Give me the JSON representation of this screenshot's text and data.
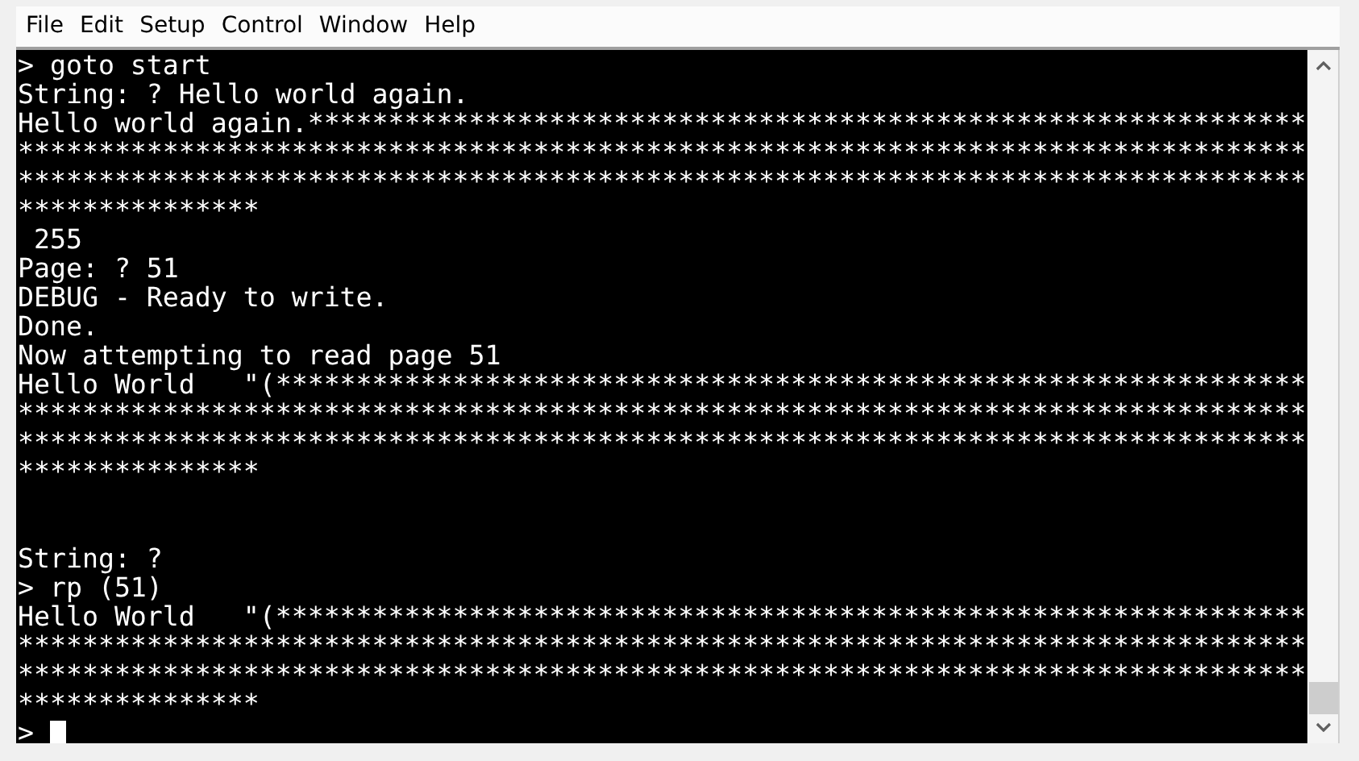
{
  "menu": [
    "File",
    "Edit",
    "Setup",
    "Control",
    "Window",
    "Help"
  ],
  "terminal": {
    "lines": [
      {
        "kind": "text",
        "text": "> goto start"
      },
      {
        "kind": "text",
        "text": "String: ? Hello world again."
      },
      {
        "kind": "text",
        "text": "Hello world again.**************************************************************"
      },
      {
        "kind": "text",
        "text": "********************************************************************************"
      },
      {
        "kind": "text",
        "text": "********************************************************************************"
      },
      {
        "kind": "text",
        "text": "***************"
      },
      {
        "kind": "text",
        "text": " 255"
      },
      {
        "kind": "text",
        "text": "Page: ? 51"
      },
      {
        "kind": "text",
        "text": "DEBUG - Ready to write."
      },
      {
        "kind": "text",
        "text": "Done."
      },
      {
        "kind": "text",
        "text": "Now attempting to read page 51"
      },
      {
        "kind": "text",
        "text": "Hello World   \"(****************************************************************"
      },
      {
        "kind": "text",
        "text": "********************************************************************************"
      },
      {
        "kind": "text",
        "text": "********************************************************************************"
      },
      {
        "kind": "text",
        "text": "***************"
      },
      {
        "kind": "blank"
      },
      {
        "kind": "blank"
      },
      {
        "kind": "text",
        "text": "String: ?"
      },
      {
        "kind": "text",
        "text": "> rp (51)"
      },
      {
        "kind": "text",
        "text": "Hello World   \"(****************************************************************"
      },
      {
        "kind": "text",
        "text": "********************************************************************************"
      },
      {
        "kind": "text",
        "text": "********************************************************************************"
      },
      {
        "kind": "text",
        "text": "***************"
      },
      {
        "kind": "prompt",
        "text": ">"
      }
    ]
  }
}
